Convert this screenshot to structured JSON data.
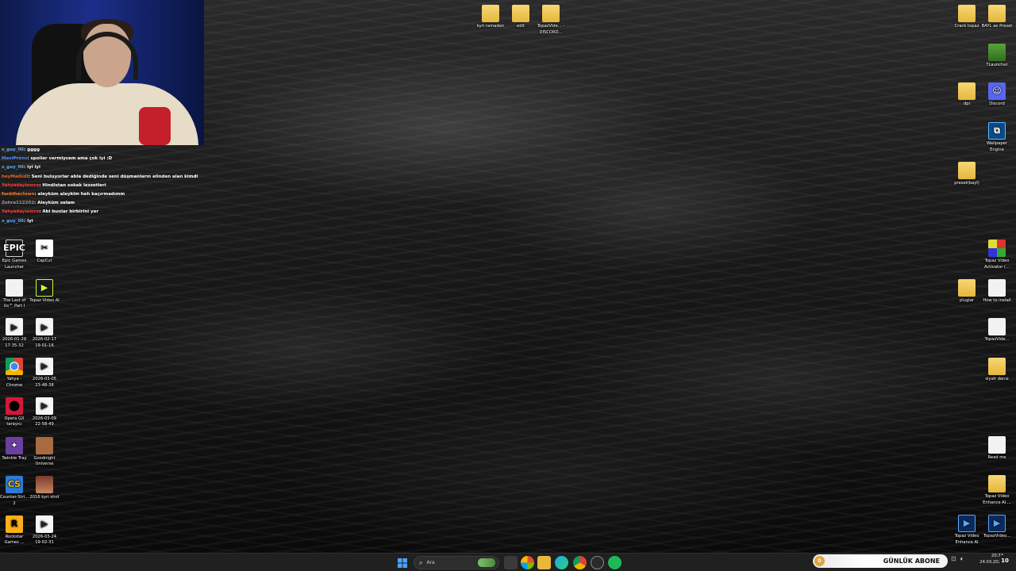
{
  "chat": [
    {
      "user": "x_guy_06",
      "text": ": gggg",
      "color": "#5aa6ff"
    },
    {
      "user": "MaviPrens",
      "text": ": spoiler vermiycem ama çok iyi :D",
      "color": "#4f8cff"
    },
    {
      "user": "x_guy_06",
      "text": ": iyi iyi",
      "color": "#5aa6ff"
    },
    {
      "user": "heyMadsdl",
      "text": ": Seni buluyorlar abla dediğinde seni düşmanların elinden alan kimdi",
      "color": "#e0622b"
    },
    {
      "user": "Yahyadayiemre",
      "text": ": Hindistan sokak lezzetleri",
      "color": "#ff3a3a"
    },
    {
      "user": "fucktheclown",
      "text": ": aleyküm aleykim heh kaçırmadımm",
      "color": "#ff7a2a"
    },
    {
      "user": "Zehra112202",
      "text": ": Aleyküm selam",
      "color": "#9a9a9a"
    },
    {
      "user": "Yahyadayiemre",
      "text": ": Abi bunlar birbirini yer",
      "color": "#ff3a3a"
    },
    {
      "user": "x_guy_06",
      "text": ": lyi",
      "color": "#5aa6ff"
    }
  ],
  "icons_top": [
    {
      "name": "kyri-ramaden-folder",
      "label": "kyri ramaden",
      "glyph": "",
      "kind": "g-folder",
      "badge": true
    },
    {
      "name": "edit-folder",
      "label": "edit",
      "glyph": "",
      "kind": "g-folder",
      "badge": false
    },
    {
      "name": "topaz-video-discord-folder",
      "label": "TopazVide... - DISCORD...",
      "glyph": "",
      "kind": "g-folder",
      "badge": true
    }
  ],
  "icons_left": [
    {
      "name": "epic-games-launcher-icon",
      "label": "Epic Games Launcher",
      "glyph": "EPIC",
      "kind": "g-epic"
    },
    {
      "name": "capcut-icon",
      "label": "CapCut",
      "glyph": "✂",
      "kind": "g-capcut"
    },
    {
      "name": "the-last-of-us-icon",
      "label": "The Last of Us™ Part I",
      "glyph": "",
      "kind": "g-file"
    },
    {
      "name": "topaz-video-ai-icon",
      "label": "Topaz Video AI",
      "glyph": "▶",
      "kind": "g-topaz"
    },
    {
      "name": "video-2026-01-29-icon",
      "label": "2026-01-29 17-35-32",
      "glyph": "▶",
      "kind": "g-video"
    },
    {
      "name": "video-2026-02-17-icon",
      "label": "2026-02-17 19-01-16",
      "glyph": "▶",
      "kind": "g-video"
    },
    {
      "name": "yahya-chrome-icon",
      "label": "Yahya - Chrome",
      "glyph": "",
      "kind": "g-chrome"
    },
    {
      "name": "video-2026-03-05-icon",
      "label": "2026-03-05 23-48-38",
      "glyph": "▶",
      "kind": "g-video"
    },
    {
      "name": "opera-gx-icon",
      "label": "Opera GX tarayıcı",
      "glyph": "",
      "kind": "g-opera"
    },
    {
      "name": "video-2026-03-09-icon",
      "label": "2026-03-09 22-58-49",
      "glyph": "▶",
      "kind": "g-video"
    },
    {
      "name": "twinkle-tray-icon",
      "label": "Twinkle Tray",
      "glyph": "✦",
      "kind": "g-twinkle"
    },
    {
      "name": "goodnight-universe-icon",
      "label": "Goodnight Universe",
      "glyph": "",
      "kind": "g-goodnight"
    },
    {
      "name": "counter-strike-2-icon",
      "label": "Counter-Stri... 2",
      "glyph": "CS",
      "kind": "g-cs"
    },
    {
      "name": "2016-kyri-shot-icon",
      "label": "2016 kyri shot",
      "glyph": "",
      "kind": "g-photo"
    },
    {
      "name": "rockstar-games-icon",
      "label": "Rockstar Games ...",
      "glyph": "R",
      "kind": "g-rockstar"
    },
    {
      "name": "video-2026-03-24-icon",
      "label": "2026-03-24 19-02-31",
      "glyph": "▶",
      "kind": "g-video"
    }
  ],
  "icons_right": [
    {
      "name": "crack-topaz-folder",
      "label": "Crack topaz",
      "glyph": "",
      "kind": "g-folder"
    },
    {
      "name": "bayl-ae-preset-folder",
      "label": "BAYL ae Preset",
      "glyph": "",
      "kind": "g-folder"
    },
    {
      "name": "tlauncher-icon",
      "label": "TLauncher",
      "glyph": "",
      "kind": "g-tlauncher"
    },
    {
      "name": "dpi-folder",
      "label": "dpi",
      "glyph": "",
      "kind": "g-folder"
    },
    {
      "name": "discord-icon",
      "label": "Discord",
      "glyph": "☺",
      "kind": "g-discord"
    },
    {
      "name": "wallpaper-engine-icon",
      "label": "Wallpaper Engine",
      "glyph": "⧉",
      "kind": "g-wallpaper"
    },
    {
      "name": "preset-bayl-folder",
      "label": "preset(bayl)",
      "glyph": "",
      "kind": "g-folder"
    },
    {
      "name": "topaz-video-activator-icon",
      "label": "Topaz Video Activator (...",
      "glyph": "",
      "kind": "g-activator"
    },
    {
      "name": "pluglar-folder",
      "label": "pluglar",
      "glyph": "",
      "kind": "g-folder"
    },
    {
      "name": "how-to-install-icon",
      "label": "How to install",
      "glyph": "",
      "kind": "g-file"
    },
    {
      "name": "topaz-video-file-icon",
      "label": "TopazVide...",
      "glyph": "",
      "kind": "g-file"
    },
    {
      "name": "siyah-deniz-folder",
      "label": "siyah deniz",
      "glyph": "",
      "kind": "g-folder"
    },
    {
      "name": "read-me-icon",
      "label": "Read me",
      "glyph": "",
      "kind": "g-file"
    },
    {
      "name": "topaz-video-enhance-ai-folder",
      "label": "Topaz Video Enhance AI ...",
      "glyph": "",
      "kind": "g-folder"
    },
    {
      "name": "topaz-video-enhance-ai-icon",
      "label": "Topaz Video Enhance AI",
      "glyph": "▶",
      "kind": "g-topazv"
    },
    {
      "name": "topaz-video-shortcut-icon",
      "label": "TopazVideo...",
      "glyph": "▶",
      "kind": "g-topazv"
    }
  ],
  "taskbar": {
    "search_placeholder": "Ara",
    "notification_text": "GÜNLÜK ABONE",
    "notification_count": "0",
    "clock_time": "20:33",
    "clock_date": "24.03.2026",
    "badge_count": "10"
  }
}
